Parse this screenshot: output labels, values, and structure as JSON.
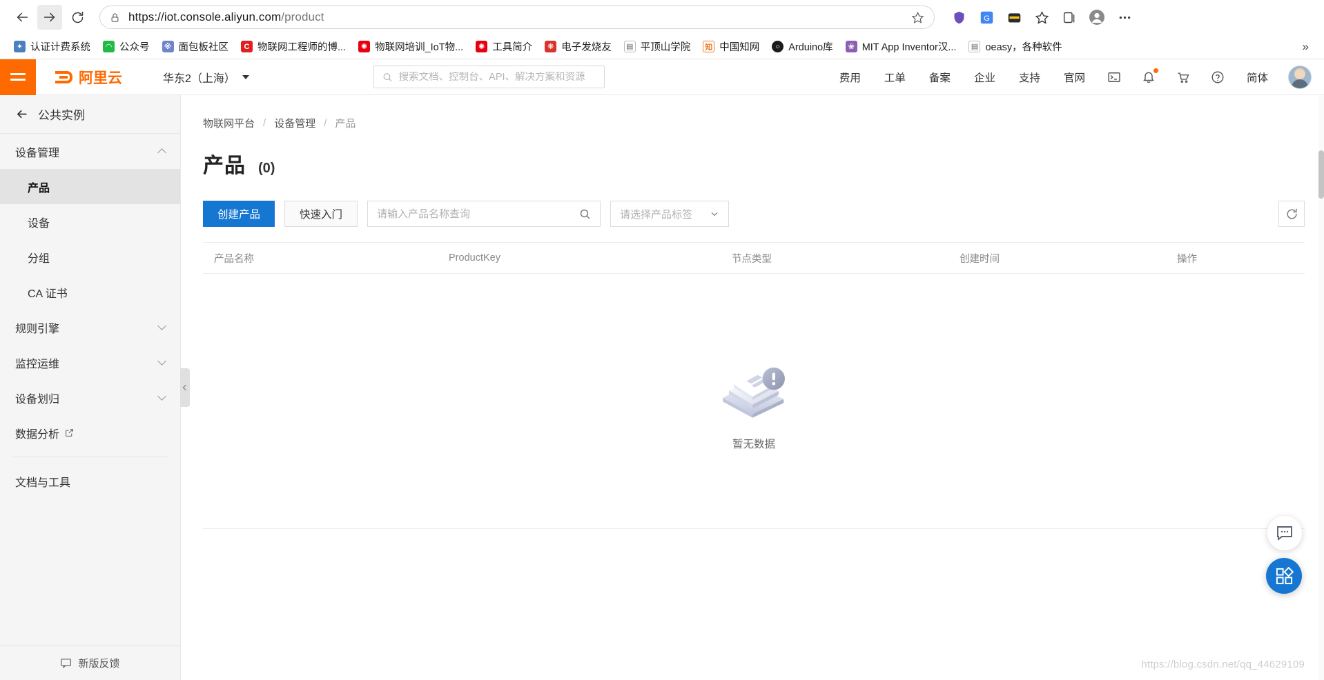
{
  "browser": {
    "back_icon": "arrow-left-icon",
    "forward_icon": "arrow-right-icon",
    "reload_icon": "reload-icon",
    "lock_icon": "lock-icon",
    "url_protocol": "https://",
    "url_host": "iot.console.aliyun.com",
    "url_path": "/product",
    "star_icon": "star-icon",
    "extensions": [
      "shield-icon",
      "translate-icon",
      "wallet-icon",
      "favorites-icon",
      "collections-icon",
      "profile-icon",
      "more-icon"
    ],
    "bookmarks": [
      {
        "label": "认证计费系统",
        "color": "#4a7fc1"
      },
      {
        "label": "公众号",
        "color": "#21ba45"
      },
      {
        "label": "面包板社区",
        "color": "#6e86c8"
      },
      {
        "label": "物联网工程师的博...",
        "color": "#e02020"
      },
      {
        "label": "物联网培训_IoT物...",
        "color": "#e60012"
      },
      {
        "label": "工具简介",
        "color": "#e60012"
      },
      {
        "label": "电子发烧友",
        "color": "#d9342b"
      },
      {
        "label": "平顶山学院",
        "color": "#ffffff"
      },
      {
        "label": "中国知网",
        "color": "#f07a22"
      },
      {
        "label": "Arduino库",
        "color": "#1b1b1b"
      },
      {
        "label": "MIT App Inventor汉...",
        "color": "#8e5fb0"
      },
      {
        "label": "oeasy，各种软件",
        "color": "#ffffff"
      }
    ],
    "bookmarks_overflow": "»"
  },
  "header": {
    "menu_icon": "hamburger-menu-icon",
    "logo_text": "阿里云",
    "region": "华东2（上海）",
    "search_placeholder": "搜索文档、控制台、API、解决方案和资源",
    "search_value": "",
    "search_icon": "search-icon",
    "nav_items": [
      "费用",
      "工单",
      "备案",
      "企业",
      "支持",
      "官网"
    ],
    "icon_items": [
      "terminal-icon",
      "bell-icon",
      "cart-icon",
      "help-icon"
    ],
    "language": "简体",
    "avatar": "avatar",
    "brand_orange": "#ff6a00"
  },
  "sidebar": {
    "back_label": "公共实例",
    "back_icon": "arrow-left-icon",
    "groups": [
      {
        "label": "设备管理",
        "expanded": true,
        "chevron": "chevron-up-icon"
      }
    ],
    "items": [
      {
        "label": "产品",
        "active": true
      },
      {
        "label": "设备",
        "active": false
      },
      {
        "label": "分组",
        "active": false
      },
      {
        "label": "CA 证书",
        "active": false
      }
    ],
    "collapsed_groups": [
      {
        "label": "规则引擎",
        "chevron": "chevron-down-icon"
      },
      {
        "label": "监控运维",
        "chevron": "chevron-down-icon"
      },
      {
        "label": "设备划归",
        "chevron": "chevron-down-icon"
      }
    ],
    "external_link": {
      "label": "数据分析",
      "icon": "external-link-icon"
    },
    "docs_tools": "文档与工具",
    "feedback": {
      "label": "新版反馈",
      "icon": "feedback-icon"
    },
    "collapse_icon": "chevron-left-icon"
  },
  "main": {
    "breadcrumb": [
      "物联网平台",
      "设备管理",
      "产品"
    ],
    "breadcrumb_sep": "/",
    "title": "产品",
    "count": "(0)",
    "toolbar": {
      "create_label": "创建产品",
      "quickstart_label": "快速入门",
      "search_placeholder": "请输入产品名称查询",
      "search_value": "",
      "search_icon": "search-icon",
      "tag_placeholder": "请选择产品标签",
      "tag_chevron": "chevron-down-icon",
      "refresh_icon": "refresh-icon"
    },
    "table": {
      "columns": [
        "产品名称",
        "ProductKey",
        "节点类型",
        "创建时间",
        "操作"
      ],
      "rows": []
    },
    "empty": {
      "label": "暂无数据",
      "icon": "empty-box-icon"
    },
    "fab_chat": "chat-icon",
    "fab_apps": "apps-grid-icon",
    "watermark": "https://blog.csdn.net/qq_44629109",
    "accent_blue": "#1677d2"
  }
}
